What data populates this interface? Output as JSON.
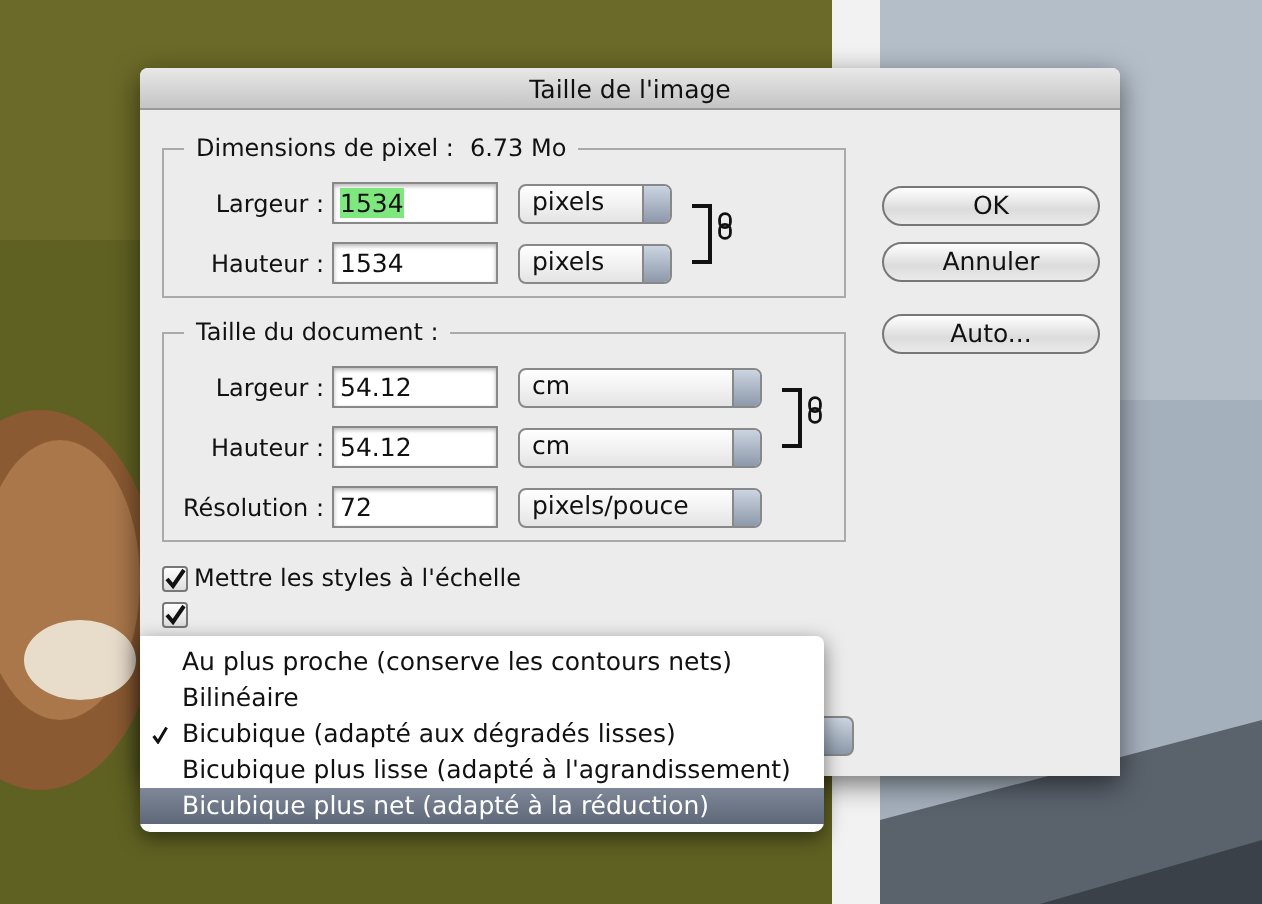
{
  "window": {
    "title": "Taille de l'image"
  },
  "pixel_dimensions": {
    "legend": "Dimensions de pixel :",
    "size": "6.73 Mo",
    "linked": true,
    "fields": [
      {
        "label": "Largeur :",
        "value": "1534",
        "text_selected": true,
        "unit": "pixels"
      },
      {
        "label": "Hauteur :",
        "value": "1534",
        "text_selected": false,
        "unit": "pixels"
      }
    ]
  },
  "document_size": {
    "legend": "Taille du document :",
    "linked": true,
    "fields": [
      {
        "label": "Largeur :",
        "value": "54.12",
        "text_selected": false,
        "unit": "cm"
      },
      {
        "label": "Hauteur :",
        "value": "54.12",
        "text_selected": false,
        "unit": "cm"
      },
      {
        "label": "Résolution :",
        "value": "72",
        "text_selected": false,
        "unit": "pixels/pouce"
      }
    ]
  },
  "checkboxes": [
    {
      "label": "Mettre les styles à l'échelle",
      "checked": true
    },
    {
      "checked": true
    }
  ],
  "buttons": [
    "OK",
    "Annuler",
    "Auto..."
  ],
  "menu": {
    "items": [
      {
        "label": "Au plus proche (conserve les contours nets)",
        "checked": false,
        "selected": false
      },
      {
        "label": "Bilinéaire",
        "checked": false,
        "selected": false
      },
      {
        "label": "Bicubique (adapté aux dégradés lisses)",
        "checked": true,
        "selected": false
      },
      {
        "label": "Bicubique plus lisse (adapté à l'agrandissement)",
        "checked": false,
        "selected": false
      },
      {
        "label": "Bicubique plus net (adapté à la réduction)",
        "checked": false,
        "selected": true
      }
    ]
  }
}
